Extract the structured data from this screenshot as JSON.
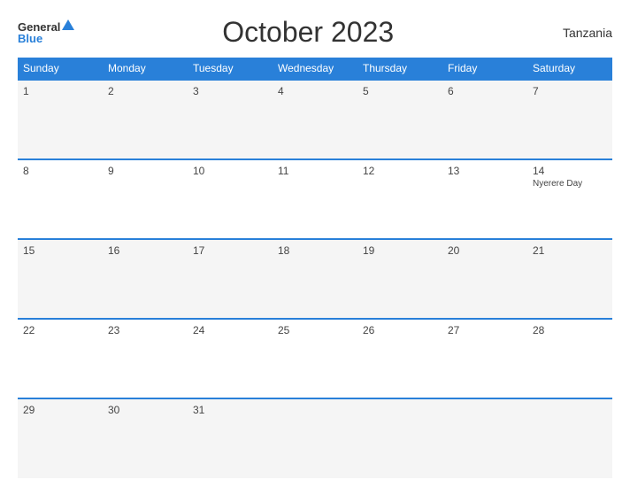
{
  "logo": {
    "general": "General",
    "blue": "Blue"
  },
  "title": "October 2023",
  "country": "Tanzania",
  "days_header": [
    "Sunday",
    "Monday",
    "Tuesday",
    "Wednesday",
    "Thursday",
    "Friday",
    "Saturday"
  ],
  "weeks": [
    [
      {
        "day": "1",
        "holiday": ""
      },
      {
        "day": "2",
        "holiday": ""
      },
      {
        "day": "3",
        "holiday": ""
      },
      {
        "day": "4",
        "holiday": ""
      },
      {
        "day": "5",
        "holiday": ""
      },
      {
        "day": "6",
        "holiday": ""
      },
      {
        "day": "7",
        "holiday": ""
      }
    ],
    [
      {
        "day": "8",
        "holiday": ""
      },
      {
        "day": "9",
        "holiday": ""
      },
      {
        "day": "10",
        "holiday": ""
      },
      {
        "day": "11",
        "holiday": ""
      },
      {
        "day": "12",
        "holiday": ""
      },
      {
        "day": "13",
        "holiday": ""
      },
      {
        "day": "14",
        "holiday": "Nyerere Day"
      }
    ],
    [
      {
        "day": "15",
        "holiday": ""
      },
      {
        "day": "16",
        "holiday": ""
      },
      {
        "day": "17",
        "holiday": ""
      },
      {
        "day": "18",
        "holiday": ""
      },
      {
        "day": "19",
        "holiday": ""
      },
      {
        "day": "20",
        "holiday": ""
      },
      {
        "day": "21",
        "holiday": ""
      }
    ],
    [
      {
        "day": "22",
        "holiday": ""
      },
      {
        "day": "23",
        "holiday": ""
      },
      {
        "day": "24",
        "holiday": ""
      },
      {
        "day": "25",
        "holiday": ""
      },
      {
        "day": "26",
        "holiday": ""
      },
      {
        "day": "27",
        "holiday": ""
      },
      {
        "day": "28",
        "holiday": ""
      }
    ],
    [
      {
        "day": "29",
        "holiday": ""
      },
      {
        "day": "30",
        "holiday": ""
      },
      {
        "day": "31",
        "holiday": ""
      },
      {
        "day": "",
        "holiday": ""
      },
      {
        "day": "",
        "holiday": ""
      },
      {
        "day": "",
        "holiday": ""
      },
      {
        "day": "",
        "holiday": ""
      }
    ]
  ]
}
